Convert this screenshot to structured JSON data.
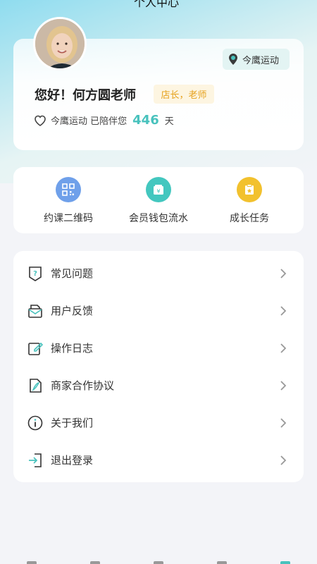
{
  "header": {
    "title": "个人中心"
  },
  "profile": {
    "brand_badge": "今鹰运动",
    "greeting": "您好！何方圆老师",
    "role": "店长，老师",
    "days_prefix": "今鹰运动 已陪伴您",
    "days_count": "446",
    "days_suffix": "天"
  },
  "quick_actions": [
    {
      "label": "约课二维码",
      "icon": "qrcode-icon",
      "color": "#6fa0ea"
    },
    {
      "label": "会员钱包流水",
      "icon": "wallet-icon",
      "color": "#43c7bf"
    },
    {
      "label": "成长任务",
      "icon": "task-icon",
      "color": "#f2c12e"
    }
  ],
  "menu": [
    {
      "label": "常见问题",
      "icon": "faq-icon"
    },
    {
      "label": "用户反馈",
      "icon": "feedback-icon"
    },
    {
      "label": "操作日志",
      "icon": "log-icon"
    },
    {
      "label": "商家合作协议",
      "icon": "agreement-icon"
    },
    {
      "label": "关于我们",
      "icon": "info-icon"
    },
    {
      "label": "退出登录",
      "icon": "logout-icon"
    }
  ],
  "colors": {
    "accent": "#48c2bd",
    "role_text": "#e6a21e",
    "role_bg": "#fdf5e1"
  }
}
